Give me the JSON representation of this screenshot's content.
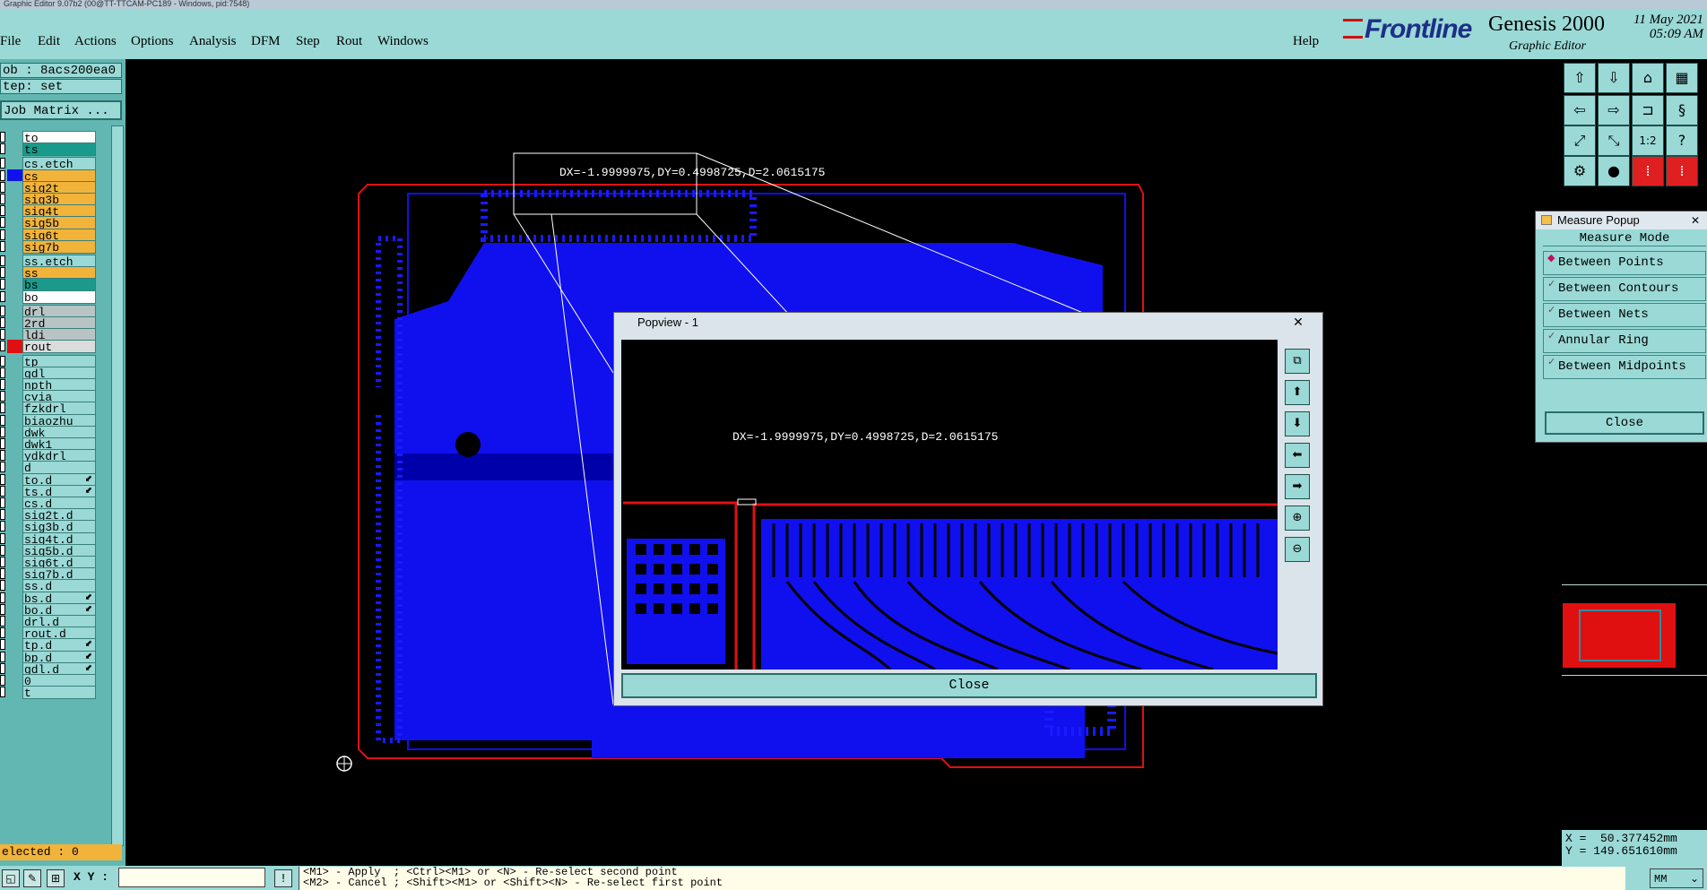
{
  "window": {
    "title": "Graphic Editor 9.07b2 (00@TT-TTCAM-PC189 - Windows, pid:7548)"
  },
  "menu": {
    "items": [
      "File",
      "Edit",
      "Actions",
      "Options",
      "Analysis",
      "DFM",
      "Step",
      "Rout",
      "Windows"
    ],
    "help": "Help"
  },
  "brand": {
    "logo": "Frontline",
    "product": "Genesis 2000",
    "subtitle": "Graphic Editor",
    "date": "11 May 2021",
    "time": "05:09 AM"
  },
  "job": {
    "job_label": "ob : 8acs200ea0",
    "step_label": "tep: set",
    "matrix_button": "Job Matrix ..."
  },
  "layers": [
    {
      "name": "to",
      "bg": "#ffffff",
      "col": "#62b7b2"
    },
    {
      "name": "ts",
      "bg": "#1a9a8a",
      "col": "#62b7b2"
    },
    {
      "name": "cs.etch",
      "bg": "#9ad9d6",
      "col": "#62b7b2"
    },
    {
      "name": "cs",
      "bg": "#f2b33a",
      "col": "#1111ee"
    },
    {
      "name": "sig2t",
      "bg": "#f2b33a",
      "col": "#62b7b2"
    },
    {
      "name": "sig3b",
      "bg": "#f2b33a",
      "col": "#62b7b2"
    },
    {
      "name": "sig4t",
      "bg": "#f2b33a",
      "col": "#62b7b2"
    },
    {
      "name": "sig5b",
      "bg": "#f2b33a",
      "col": "#62b7b2"
    },
    {
      "name": "sig6t",
      "bg": "#f2b33a",
      "col": "#62b7b2"
    },
    {
      "name": "sig7b",
      "bg": "#f2b33a",
      "col": "#62b7b2"
    },
    {
      "name": "ss.etch",
      "bg": "#9ad9d6",
      "col": "#62b7b2"
    },
    {
      "name": "ss",
      "bg": "#f2b33a",
      "col": "#62b7b2"
    },
    {
      "name": "bs",
      "bg": "#1a9a8a",
      "col": "#62b7b2"
    },
    {
      "name": "bo",
      "bg": "#ffffff",
      "col": "#62b7b2"
    },
    {
      "name": "drl",
      "bg": "#b8c4c4",
      "col": "#62b7b2"
    },
    {
      "name": "2rd",
      "bg": "#b8c4c4",
      "col": "#62b7b2"
    },
    {
      "name": "ldi",
      "bg": "#b8c4c4",
      "col": "#62b7b2"
    },
    {
      "name": "rout",
      "bg": "#dcdcdc",
      "col": "#e01010"
    },
    {
      "name": "tp",
      "bg": "#9ad9d6",
      "col": "#62b7b2"
    },
    {
      "name": "gdl",
      "bg": "#9ad9d6",
      "col": "#62b7b2"
    },
    {
      "name": "npth",
      "bg": "#9ad9d6",
      "col": "#62b7b2"
    },
    {
      "name": "cvia",
      "bg": "#9ad9d6",
      "col": "#62b7b2"
    },
    {
      "name": "fzkdrl",
      "bg": "#9ad9d6",
      "col": "#62b7b2"
    },
    {
      "name": "biaozhu",
      "bg": "#9ad9d6",
      "col": "#62b7b2"
    },
    {
      "name": "dwk",
      "bg": "#9ad9d6",
      "col": "#62b7b2"
    },
    {
      "name": "dwk1",
      "bg": "#9ad9d6",
      "col": "#62b7b2"
    },
    {
      "name": "ydkdrl",
      "bg": "#9ad9d6",
      "col": "#62b7b2"
    },
    {
      "name": "d",
      "bg": "#9ad9d6",
      "col": "#62b7b2"
    },
    {
      "name": "to.d",
      "bg": "#9ad9d6",
      "col": "#62b7b2",
      "flag": "⬋"
    },
    {
      "name": "ts.d",
      "bg": "#9ad9d6",
      "col": "#62b7b2",
      "flag": "⬋"
    },
    {
      "name": "cs.d",
      "bg": "#9ad9d6",
      "col": "#62b7b2"
    },
    {
      "name": "sig2t.d",
      "bg": "#9ad9d6",
      "col": "#62b7b2"
    },
    {
      "name": "sig3b.d",
      "bg": "#9ad9d6",
      "col": "#62b7b2"
    },
    {
      "name": "sig4t.d",
      "bg": "#9ad9d6",
      "col": "#62b7b2"
    },
    {
      "name": "sig5b.d",
      "bg": "#9ad9d6",
      "col": "#62b7b2"
    },
    {
      "name": "sig6t.d",
      "bg": "#9ad9d6",
      "col": "#62b7b2"
    },
    {
      "name": "sig7b.d",
      "bg": "#9ad9d6",
      "col": "#62b7b2"
    },
    {
      "name": "ss.d",
      "bg": "#9ad9d6",
      "col": "#62b7b2"
    },
    {
      "name": "bs.d",
      "bg": "#9ad9d6",
      "col": "#62b7b2",
      "flag": "⬋"
    },
    {
      "name": "bo.d",
      "bg": "#9ad9d6",
      "col": "#62b7b2",
      "flag": "⬋"
    },
    {
      "name": "drl.d",
      "bg": "#9ad9d6",
      "col": "#62b7b2"
    },
    {
      "name": "rout.d",
      "bg": "#9ad9d6",
      "col": "#62b7b2"
    },
    {
      "name": "tp.d",
      "bg": "#9ad9d6",
      "col": "#62b7b2",
      "flag": "⬋"
    },
    {
      "name": "bp.d",
      "bg": "#9ad9d6",
      "col": "#62b7b2",
      "flag": "⬋"
    },
    {
      "name": "gdl.d",
      "bg": "#9ad9d6",
      "col": "#62b7b2",
      "flag": "⬋"
    },
    {
      "name": "0",
      "bg": "#9ad9d6",
      "col": "#62b7b2"
    },
    {
      "name": "t",
      "bg": "#9ad9d6",
      "col": "#62b7b2"
    }
  ],
  "selected": "elected : 0",
  "measure": {
    "readout": "DX=-1.9999975,DY=0.4998725,D=2.0615175",
    "popup_title": "Measure Popup",
    "mode_header": "Measure Mode",
    "options": [
      {
        "label": "Between Points",
        "selected": true
      },
      {
        "label": "Between Contours",
        "selected": false
      },
      {
        "label": "Between Nets",
        "selected": false
      },
      {
        "label": "Annular Ring",
        "selected": false
      },
      {
        "label": "Between Midpoints",
        "selected": false
      }
    ],
    "close": "Close"
  },
  "popview": {
    "title": "Popview - 1",
    "close_x": "✕",
    "close": "Close"
  },
  "coords": {
    "x": "X =  50.377452mm",
    "y": "Y = 149.651610mm"
  },
  "status": {
    "xy_label": "X Y :",
    "hint1": "<M1> - Apply  ; <Ctrl><M1> or <N> - Re-select second point",
    "hint2": "<M2> - Cancel ; <Shift><M1> or <Shift><N> - Re-select first point",
    "units": "MM"
  },
  "colors": {
    "bg": "#000000",
    "panel": "#9ad9d6",
    "copper": "#1010ee",
    "outline": "#e01010"
  }
}
